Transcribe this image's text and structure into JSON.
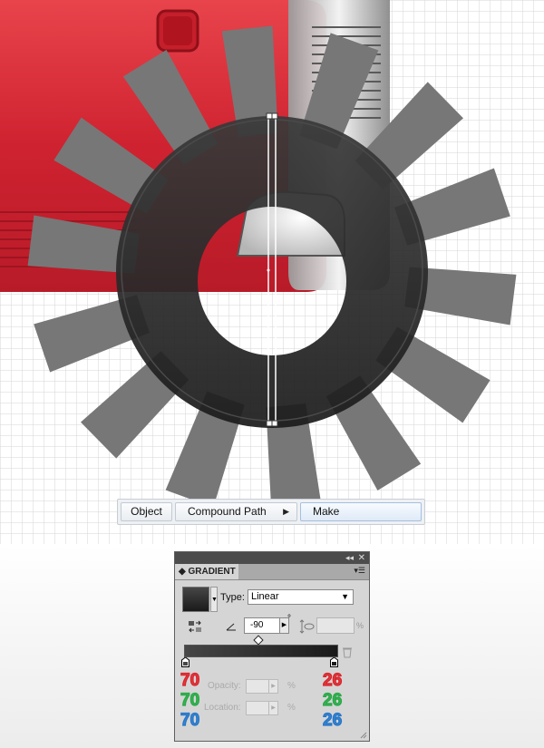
{
  "context_menu": {
    "items": [
      "Object",
      "Compound Path",
      "Make"
    ],
    "submenu_arrow": "triangle-right-icon"
  },
  "gradient_panel": {
    "title": "GRADIENT",
    "type_label": "Type:",
    "type_value": "Linear",
    "angle_value": "-90",
    "degree_symbol": "°",
    "aspect_unit": "%",
    "opacity_label": "Opacity:",
    "location_label": "Location:",
    "percent": "%",
    "start_color": {
      "r": "70",
      "g": "70",
      "b": "70",
      "hex": "#464646"
    },
    "end_color": {
      "r": "26",
      "g": "26",
      "b": "26",
      "hex": "#1a1a1a"
    }
  },
  "colors": {
    "red_body": "#d42a35",
    "grid_line": "#d8d8d8",
    "ring": "#2a2a2a",
    "spokes": "#777777",
    "panel_header": "#4c4c4c"
  }
}
